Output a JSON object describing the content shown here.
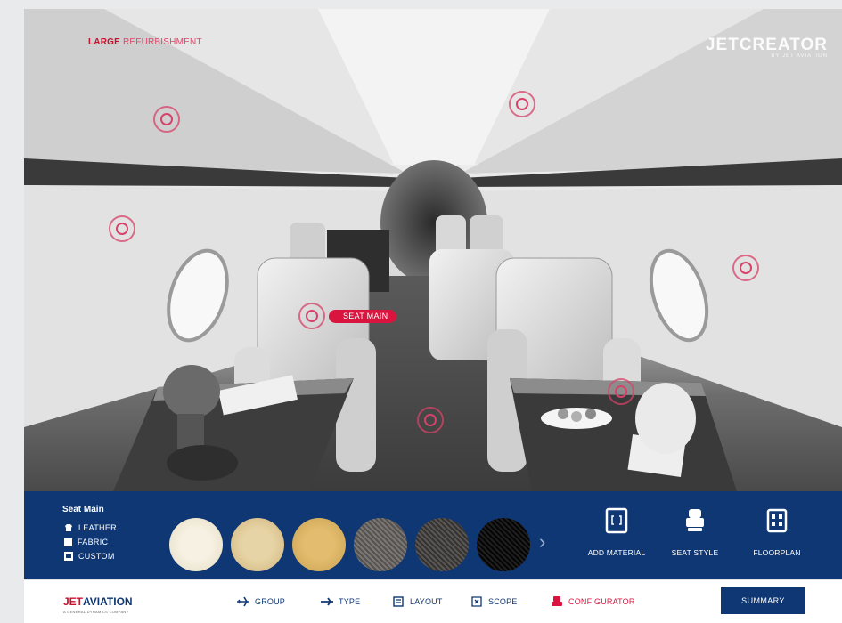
{
  "header": {
    "title_strong": "LARGE",
    "title_light": "REFURBISHMENT",
    "brand": "JETCREATOR",
    "brand_sub": "BY JET AVIATION"
  },
  "hotspot_label": "SEAT MAIN",
  "config": {
    "section_title": "Seat Main",
    "material_options": [
      "LEATHER",
      "FABRIC",
      "CUSTOM"
    ],
    "swatches": [
      {
        "name": "cream-perforated",
        "color": "#efe7d4"
      },
      {
        "name": "beige-perforated",
        "color": "#dcc592"
      },
      {
        "name": "gold-perforated",
        "color": "#d6ae62"
      },
      {
        "name": "grey-mesh",
        "color": "#6f6c68"
      },
      {
        "name": "dark-grey-mesh",
        "color": "#4a4846"
      },
      {
        "name": "black-mesh",
        "color": "#111111"
      }
    ],
    "tools": [
      "ADD MATERIAL",
      "SEAT STYLE",
      "FLOORPLAN"
    ]
  },
  "footer": {
    "logo_a": "JET",
    "logo_b": "AVIATION",
    "logo_tagline": "A GENERAL DYNAMICS COMPANY",
    "nav": [
      "GROUP",
      "TYPE",
      "LAYOUT",
      "SCOPE",
      "CONFIGURATOR"
    ],
    "active_nav": "CONFIGURATOR",
    "summary_label": "SUMMARY"
  },
  "colors": {
    "accent": "#d9143f",
    "navy": "#0f3773"
  }
}
